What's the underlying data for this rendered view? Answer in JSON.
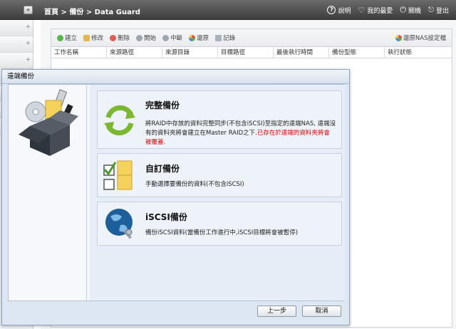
{
  "header": {
    "breadcrumb": "首頁 > 備份 > Data Guard",
    "collapse_glyph": "«",
    "links": [
      {
        "icon": "help-icon",
        "label": "說明"
      },
      {
        "icon": "favorite-icon",
        "label": "我的最愛"
      },
      {
        "icon": "power-icon",
        "label": "關機"
      },
      {
        "icon": "logout-icon",
        "label": "登出"
      }
    ]
  },
  "toolbar": {
    "items": [
      "建立",
      "修改",
      "刪除",
      "開始",
      "中斷",
      "還原",
      "記錄"
    ],
    "restore_nas": "還原NAS設定檔"
  },
  "table": {
    "columns": [
      "工作名稱",
      "來源路徑",
      "來源目錄",
      "目標路徑",
      "最後執行時間",
      "備份型態",
      "執行狀態"
    ]
  },
  "modal": {
    "title": "遠端備份",
    "options": [
      {
        "title": "完整備份",
        "desc_line1": "將RAID中存放的資料完整同步(不包含iSCSI)至指定的遠端NAS, 遠端沒",
        "desc_line2_normal": "有的資料夾將會建立在Master RAID之下.",
        "desc_line2_warn": "已存在於遠端的資料夾將會",
        "desc_line3_warn": "被覆蓋."
      },
      {
        "title": "自訂備份",
        "desc": "手動選擇要備份的資料(不包含iSCSI)"
      },
      {
        "title": "iSCSI備份",
        "desc": "備份iSCSI資料(當備份工作進行中,iSCSI目標將會被暫停)"
      }
    ],
    "prev_button": "上一步",
    "cancel_button": "取消"
  },
  "colors": {
    "header_bg": "#4a4a4a",
    "modal_bg": "#dde7f3",
    "warn": "#e00000",
    "sync_green": "#7cb82f"
  }
}
